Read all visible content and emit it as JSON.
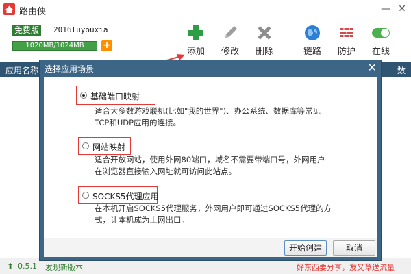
{
  "app": {
    "title": "路由侠",
    "edition": "免费版",
    "username": "2016luyouxia",
    "traffic_text": "1020MB/1024MB",
    "traffic_fraction": 0.996
  },
  "toolbar": {
    "add": "添加",
    "edit": "修改",
    "delete": "删除",
    "route": "链路",
    "protect": "防护",
    "online": "在线"
  },
  "table": {
    "col_name": "应用名称",
    "col_right": "数"
  },
  "dialog": {
    "title": "选择应用场景",
    "close": "✕",
    "options": [
      {
        "label": "基础端口映射",
        "checked": true,
        "desc_line1": "适合大多数游戏联机(比如\"我的世界\")、办公系统、数据库等常见",
        "desc_line2": "TCP和UDP应用的连接。"
      },
      {
        "label": "网站映射",
        "checked": false,
        "desc_line1": "适合开放网站，使用外网80端口，域名不需要带端口号，外网用户",
        "desc_line2": "在浏览器直接输入网址就可访问此站点。"
      },
      {
        "label": "SOCKS5代理应用",
        "checked": false,
        "desc_line1": "在本机开启SOCKS5代理服务，外网用户即可通过SOCKS5代理的方",
        "desc_line2": "式，让本机成为上网出口。"
      }
    ],
    "start_button": "开始创建",
    "cancel_button": "取消"
  },
  "status": {
    "version": "0.5.1",
    "new_version": "发现新版本",
    "promo": "好东西要分享，友又草送流量"
  },
  "colors": {
    "accent_green": "#2e7d32",
    "dialog_blue": "#3d6686",
    "highlight_red": "#e53935",
    "header_bar": "#2f5572"
  },
  "icons": {
    "add": "plus-icon",
    "edit": "pencil-icon",
    "delete": "x-icon",
    "route": "globe-icon",
    "protect": "firewall-icon",
    "online": "toggle-icon"
  }
}
